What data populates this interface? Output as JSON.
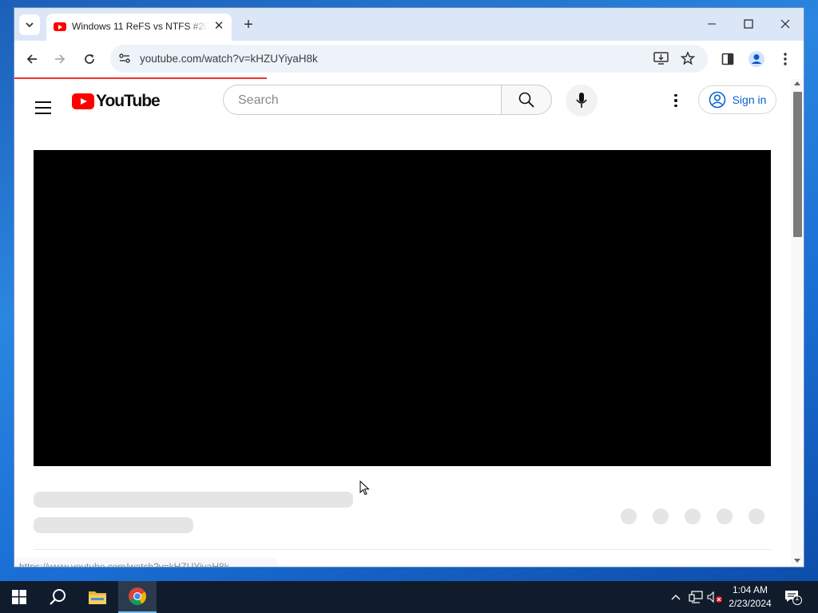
{
  "browser": {
    "tab_title": "Windows 11 ReFS vs NTFS #20...",
    "url": "youtube.com/watch?v=kHZUYiyaH8k",
    "status_url": "https://www.youtube.com/watch?v=kHZUYiyaH8k",
    "load_progress": 0.32
  },
  "youtube": {
    "logo_text": "YouTube",
    "search_placeholder": "Search",
    "signin_label": "Sign in"
  },
  "taskbar": {
    "time": "1:04 AM",
    "date": "2/23/2024",
    "notification_count": "1"
  },
  "colors": {
    "youtube_red": "#ff0000",
    "link_blue": "#065fd4",
    "tab_strip": "#dbe6f7",
    "taskbar": "#101c2b"
  }
}
